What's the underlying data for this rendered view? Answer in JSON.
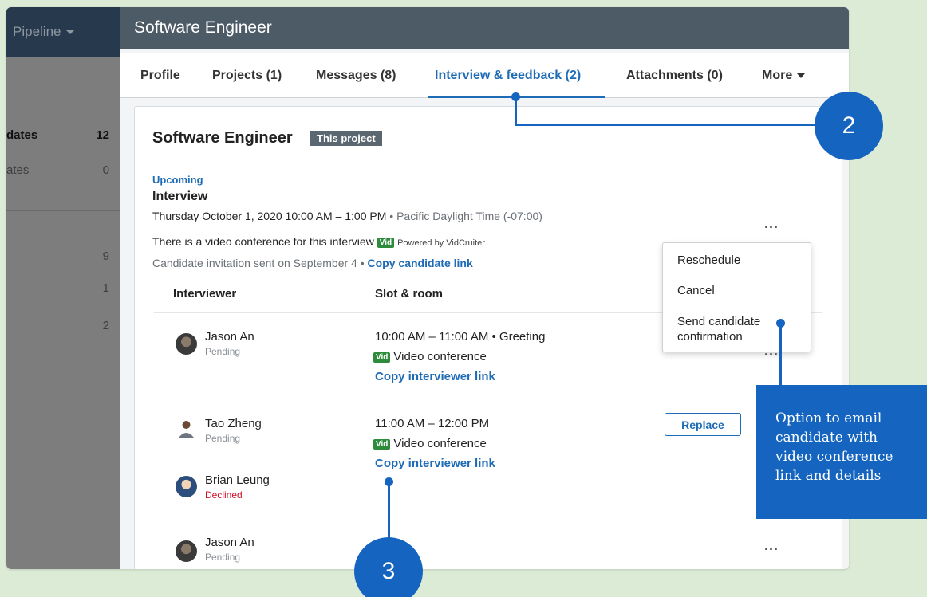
{
  "sidebar": {
    "pipeline_label": "Pipeline",
    "rows": [
      {
        "label": "dates",
        "count": "12"
      },
      {
        "label": "ates",
        "count": "0"
      }
    ],
    "counts": [
      "9",
      "1",
      "2"
    ]
  },
  "header": {
    "title": "Software Engineer"
  },
  "tabs": [
    {
      "label": "Profile"
    },
    {
      "label": "Projects (1)"
    },
    {
      "label": "Messages (8)"
    },
    {
      "label": "Interview & feedback (2)"
    },
    {
      "label": "Attachments (0)"
    },
    {
      "label": "More"
    }
  ],
  "card": {
    "title": "Software Engineer",
    "badge": "This project",
    "upcoming": "Upcoming",
    "interview_title": "Interview",
    "date_text": "Thursday October 1, 2020 10:00 AM – 1:00 PM",
    "timezone": "• Pacific Daylight Time (-07:00)",
    "video_text": "There is a video conference for this interview",
    "vid_badge": "Vid",
    "powered_by": "Powered by VidCruiter",
    "invitation_text": "Candidate invitation sent on September 4  •",
    "copy_candidate_link": "Copy candidate link",
    "more_dots": "...",
    "columns": {
      "interviewer": "Interviewer",
      "slot": "Slot & room"
    }
  },
  "rows": [
    {
      "people": [
        {
          "name": "Jason An",
          "status": "Pending"
        }
      ],
      "slot": "10:00 AM – 11:00 AM • Greeting",
      "room": "Video conference",
      "copy_link": "Copy interviewer link"
    },
    {
      "people": [
        {
          "name": "Tao Zheng",
          "status": "Pending"
        },
        {
          "name": "Brian Leung",
          "status": "Declined"
        }
      ],
      "slot": "11:00 AM – 12:00 PM",
      "room": "Video conference",
      "copy_link": "Copy interviewer link",
      "replace": "Replace"
    },
    {
      "people": [
        {
          "name": "Jason An",
          "status": "Pending"
        }
      ]
    }
  ],
  "dropdown": {
    "items": [
      "Reschedule",
      "Cancel",
      "Send candidate\nconfirmation"
    ]
  },
  "annotations": {
    "circle_2": "2",
    "circle_3": "3",
    "callout": "Option to email\ncandidate with\nvideo conference\nlink and details"
  },
  "colors": {
    "accent": "#1565c0",
    "link": "#1e6cb5",
    "header": "#4d5b67",
    "declined": "#d11124",
    "vid": "#2e8b3c"
  }
}
